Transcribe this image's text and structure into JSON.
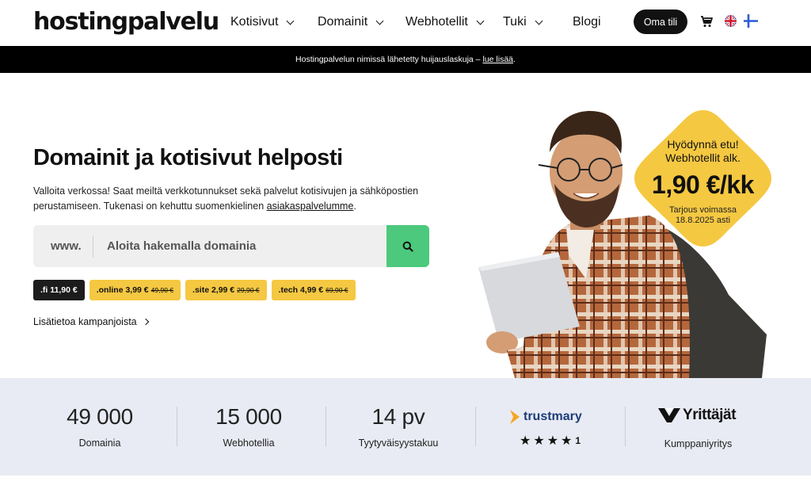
{
  "header": {
    "logo": "hostingpalvelu",
    "nav": [
      "Kotisivut",
      "Domainit",
      "Webhotellit",
      "Tuki",
      "Blogi"
    ],
    "account_label": "Oma tili"
  },
  "notice": {
    "text": "Hostingpalvelun nimissä lähetetty huijauslaskuja –",
    "link": "lue lisää",
    "end": "."
  },
  "hero": {
    "title": "Domainit ja kotisivut helposti",
    "lead_prefix": "Valloita verkossa! Saat meiltä verkkotunnukset sekä palvelut kotisivujen ja sähköpostien perustamiseen. Tukenasi on kehuttu suomenkielinen ",
    "lead_link": "asiakaspalvelumme",
    "lead_suffix": ".",
    "search_prefix": "www.",
    "search_placeholder": "Aloita hakemalla domainia",
    "chips": [
      {
        "label": ".fi 11,90 €",
        "old": ""
      },
      {
        "label": ".online 3,99 €",
        "old": "49,90 €"
      },
      {
        "label": ".site 2,99 €",
        "old": "29,90 €"
      },
      {
        "label": ".tech 4,99 €",
        "old": "69,90 €"
      }
    ],
    "more_link": "Lisätietoa kampanjoista"
  },
  "badge": {
    "line1": "Hyödynnä etu!",
    "line2": "Webhotellit alk.",
    "price": "1,90 €/kk",
    "valid1": "Tarjous voimassa",
    "valid2": "18.8.2025 asti"
  },
  "stats": {
    "items": [
      {
        "num": "49 000",
        "label": "Domainia"
      },
      {
        "num": "15 000",
        "label": "Webhotellia"
      },
      {
        "num": "14 pv",
        "label": "Tyytyväisyystakuu"
      }
    ],
    "trustmary": "trustmary",
    "rating_suffix": "1",
    "rating_value": 4.1,
    "yrittajat": "Yrittäjät",
    "partner_label": "Kumppaniyritys"
  },
  "colors": {
    "accent_green": "#4cc97c",
    "chip_yellow": "#f5c842",
    "badge_yellow": "#f5c842",
    "stats_bg": "#e8ebf3",
    "trustmary_orange": "#f5a623",
    "trustmary_navy": "#1e3c79"
  },
  "icons": [
    "chevron-down-icon",
    "cart-icon",
    "uk-flag-icon",
    "finland-flag-icon",
    "search-icon",
    "chevron-right-icon",
    "star-icon"
  ]
}
